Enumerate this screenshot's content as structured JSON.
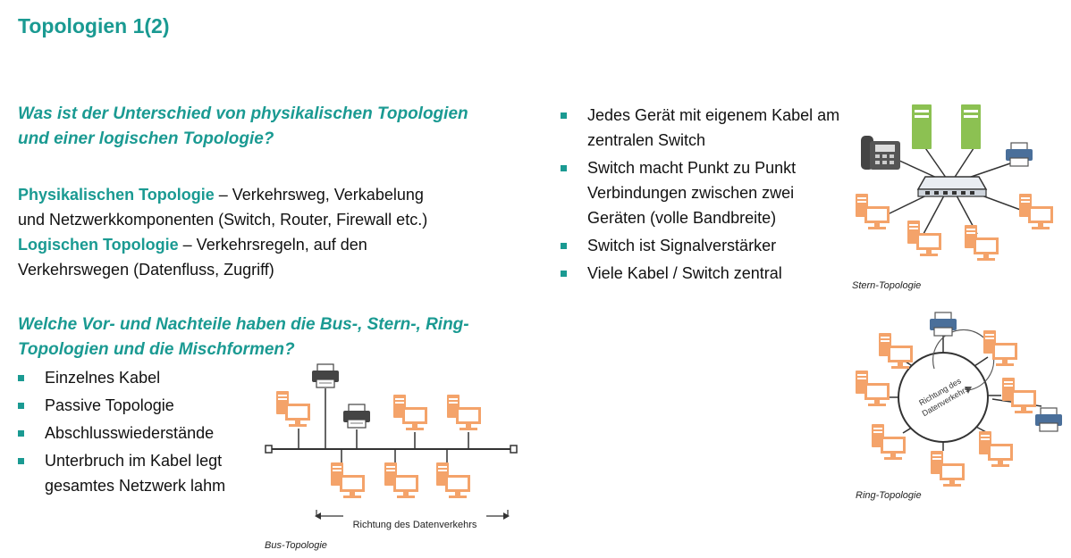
{
  "title": "Topologien 1(2)",
  "question1": {
    "line1": "Was ist der Unterschied von physikalischen Topologien",
    "line2": "und einer logischen Topologie?"
  },
  "physical": {
    "term": "Physikalischen Topologie",
    "rest": " – Verkehrsweg, Verkabelung",
    "line2": "und  Netzwerkkomponenten (Switch, Router, Firewall etc.)"
  },
  "logical": {
    "term": "Logischen Topologie",
    "rest": " – Verkehrsregeln, auf den",
    "line2": "Verkehrswegen (Datenfluss, Zugriff)"
  },
  "question2": {
    "line1": "Welche Vor- und Nachteile haben die Bus-, Stern-, Ring-",
    "line2": "Topologien und die Mischformen?"
  },
  "bus_points": [
    {
      "text": "Einzelnes Kabel"
    },
    {
      "text": "Passive Topologie"
    },
    {
      "text": "Abschlusswiederstände"
    },
    {
      "text": "Unterbruch im Kabel legt gesamtes Netzwerk lahm"
    }
  ],
  "star_points": [
    {
      "text": "Jedes Gerät mit eigenem Kabel am zentralen Switch"
    },
    {
      "text": "Switch macht Punkt zu Punkt Verbindungen zwischen zwei Geräten (volle Bandbreite)"
    },
    {
      "text": "Switch ist Signalverstärker"
    },
    {
      "text": "Viele Kabel / Switch zentral"
    }
  ],
  "figures": {
    "bus": {
      "caption": "Bus-Topologie",
      "arrow_label": "Richtung des Datenverkehrs"
    },
    "star": {
      "caption": "Stern-Topologie"
    },
    "ring": {
      "caption": "Ring-Topologie",
      "label_line1": "Richtung des",
      "label_line2": "Datenverkehrs"
    }
  },
  "colors": {
    "accent": "#1a9a92",
    "pc": "#f4a36a",
    "server": "#8cc152",
    "device": "#4a4a4a"
  }
}
